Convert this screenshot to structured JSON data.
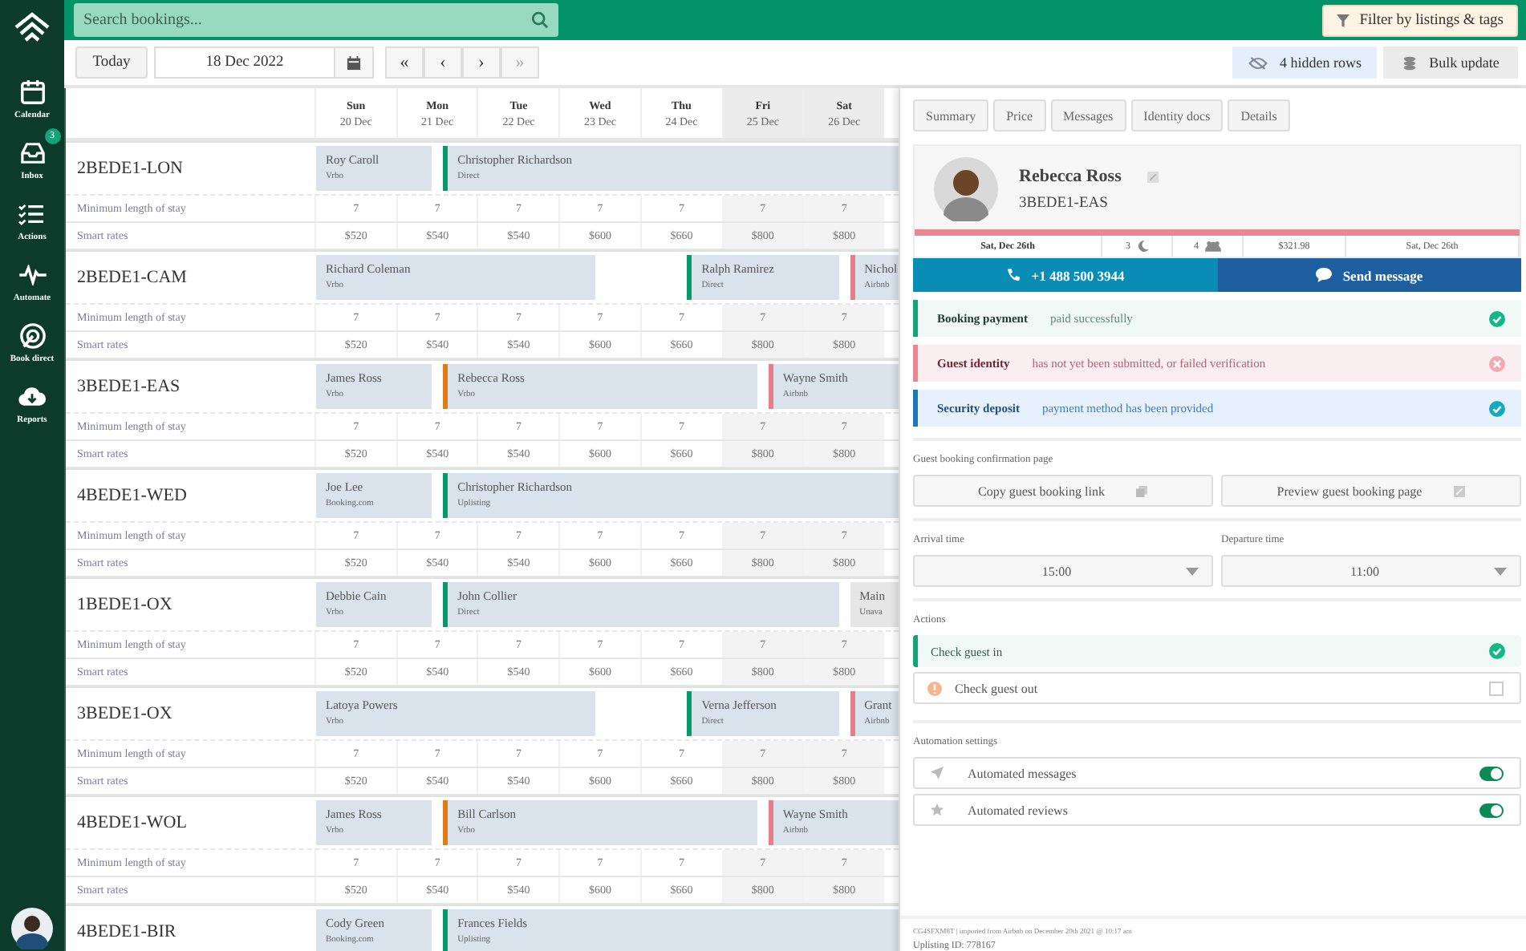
{
  "sidebar": {
    "items": [
      {
        "label": "Calendar"
      },
      {
        "label": "Inbox",
        "badge": "3"
      },
      {
        "label": "Actions"
      },
      {
        "label": "Automate"
      },
      {
        "label": "Book direct"
      },
      {
        "label": "Reports"
      }
    ]
  },
  "topbar": {
    "search": {
      "placeholder": "Search bookings..."
    },
    "filter_button": "Filter by listings & tags"
  },
  "toolbar": {
    "today_button": "Today",
    "date": "18 Dec 2022",
    "nav_buttons": [
      "«",
      "‹",
      "›",
      "»"
    ],
    "hidden_rows_button": "4 hidden rows",
    "bulk_update_button": "Bulk update"
  },
  "calendar": {
    "days": [
      {
        "weekday": "Sun",
        "date": "20 Dec",
        "weekend": false
      },
      {
        "weekday": "Mon",
        "date": "21 Dec",
        "weekend": false
      },
      {
        "weekday": "Tue",
        "date": "22 Dec",
        "weekend": false
      },
      {
        "weekday": "Wed",
        "date": "23 Dec",
        "weekend": false
      },
      {
        "weekday": "Thu",
        "date": "24 Dec",
        "weekend": false
      },
      {
        "weekday": "Fri",
        "date": "25 Dec",
        "weekend": true
      },
      {
        "weekday": "Sat",
        "date": "26 Dec",
        "weekend": true
      }
    ],
    "listings": [
      {
        "name": "2BEDE1-LON",
        "bookings": [
          {
            "kind": "booking",
            "guest": "Roy Caroll",
            "source": "Vrbo"
          },
          {
            "kind": "booking",
            "guest": "Christopher Richardson",
            "source": "Direct",
            "color": "#0a9a6a"
          }
        ],
        "min_stay_label": "Minimum length of stay",
        "min_stay": [
          "7",
          "7",
          "7",
          "7",
          "7",
          "7",
          "7"
        ],
        "rates_label": "Smart rates",
        "rates": [
          "$520",
          "$540",
          "$540",
          "$600",
          "$660",
          "$800",
          "$800"
        ]
      },
      {
        "name": "2BEDE1-CAM",
        "bookings": [
          {
            "kind": "booking",
            "guest": "Richard Coleman",
            "source": "Vrbo"
          },
          {
            "kind": "booking",
            "guest": "Ralph Ramirez",
            "source": "Direct",
            "color": "#0a9a6a"
          },
          {
            "kind": "booking",
            "guest": "Nichol",
            "source": "Airbnb",
            "color": "#e57f8a"
          }
        ],
        "min_stay_label": "Minimum length of stay",
        "min_stay": [
          "7",
          "7",
          "7",
          "7",
          "7",
          "7",
          "7"
        ],
        "rates_label": "Smart rates",
        "rates": [
          "$520",
          "$540",
          "$540",
          "$600",
          "$660",
          "$800",
          "$800"
        ]
      },
      {
        "name": "3BEDE1-EAS",
        "bookings": [
          {
            "kind": "booking",
            "guest": "James Ross",
            "source": "Vrbo"
          },
          {
            "kind": "booking",
            "guest": "Rebecca Ross",
            "source": "Vrbo",
            "color": "#e07b16"
          },
          {
            "kind": "booking",
            "guest": "Wayne Smith",
            "source": "Airbnb",
            "color": "#e57f8a"
          }
        ],
        "min_stay_label": "Minimum length of stay",
        "min_stay": [
          "7",
          "7",
          "7",
          "7",
          "7",
          "7",
          "7"
        ],
        "rates_label": "Smart rates",
        "rates": [
          "$520",
          "$540",
          "$540",
          "$600",
          "$660",
          "$800",
          "$800"
        ]
      },
      {
        "name": "4BEDE1-WED",
        "bookings": [
          {
            "kind": "booking",
            "guest": "Joe Lee",
            "source": "Booking.com"
          },
          {
            "kind": "booking",
            "guest": "Christopher Richardson",
            "source": "Uplisting",
            "color": "#0a9a6a"
          }
        ],
        "min_stay_label": "Minimum length of stay",
        "min_stay": [
          "7",
          "7",
          "7",
          "7",
          "7",
          "7",
          "7"
        ],
        "rates_label": "Smart rates",
        "rates": [
          "$520",
          "$540",
          "$540",
          "$600",
          "$660",
          "$800",
          "$800"
        ]
      },
      {
        "name": "1BEDE1-OX",
        "bookings": [
          {
            "kind": "booking",
            "guest": "Debbie Cain",
            "source": "Vrbo"
          },
          {
            "kind": "booking",
            "guest": "John Collier",
            "source": "Direct",
            "color": "#0a9a6a"
          },
          {
            "kind": "blocked",
            "guest": "Main",
            "source": "Unava"
          }
        ],
        "min_stay_label": "Minimum length of stay",
        "min_stay": [
          "7",
          "7",
          "7",
          "7",
          "7",
          "7",
          "7"
        ],
        "rates_label": "Smart rates",
        "rates": [
          "$520",
          "$540",
          "$540",
          "$600",
          "$660",
          "$800",
          "$800"
        ]
      },
      {
        "name": "3BEDE1-OX",
        "bookings": [
          {
            "kind": "booking",
            "guest": "Latoya Powers",
            "source": "Vrbo"
          },
          {
            "kind": "booking",
            "guest": "Verna Jefferson",
            "source": "Direct",
            "color": "#0a9a6a"
          },
          {
            "kind": "booking",
            "guest": "Grant",
            "source": "Airbnb",
            "color": "#e57f8a"
          }
        ],
        "min_stay_label": "Minimum length of stay",
        "min_stay": [
          "7",
          "7",
          "7",
          "7",
          "7",
          "7",
          "7"
        ],
        "rates_label": "Smart rates",
        "rates": [
          "$520",
          "$540",
          "$540",
          "$600",
          "$660",
          "$800",
          "$800"
        ]
      },
      {
        "name": "4BEDE1-WOL",
        "bookings": [
          {
            "kind": "booking",
            "guest": "James Ross",
            "source": "Vrbo"
          },
          {
            "kind": "booking",
            "guest": "Bill Carlson",
            "source": "Vrbo",
            "color": "#e07b16"
          },
          {
            "kind": "booking",
            "guest": "Wayne Smith",
            "source": "Airbnb",
            "color": "#e57f8a"
          }
        ],
        "min_stay_label": "Minimum length of stay",
        "min_stay": [
          "7",
          "7",
          "7",
          "7",
          "7",
          "7",
          "7"
        ],
        "rates_label": "Smart rates",
        "rates": [
          "$520",
          "$540",
          "$540",
          "$600",
          "$660",
          "$800",
          "$800"
        ]
      },
      {
        "name": "4BEDE1-BIR",
        "bookings": [
          {
            "kind": "booking",
            "guest": "Cody Green",
            "source": "Booking.com"
          },
          {
            "kind": "booking",
            "guest": "Frances Fields",
            "source": "Uplisting",
            "color": "#0a9a6a"
          }
        ]
      }
    ]
  },
  "panel": {
    "tabs": [
      {
        "label": "Summary",
        "selected": false
      },
      {
        "label": "Price",
        "selected": false
      },
      {
        "label": "Messages",
        "selected": false
      },
      {
        "label": "Identity docs",
        "selected": false
      },
      {
        "label": "Details",
        "selected": false
      }
    ],
    "guest": {
      "name": "Rebecca Ross",
      "listing": "3BEDE1-EAS"
    },
    "stats": [
      "Sat, Dec 26th",
      "3",
      "4",
      "$321.98",
      "Sat, Dec 26th"
    ],
    "call_button": "+1 488 500 3944",
    "message_button": "Send message",
    "statuses": [
      {
        "kind": "success",
        "title": "Booking payment",
        "text": "paid successfully"
      },
      {
        "kind": "error",
        "title": "Guest identity",
        "text": "has not yet been submitted, or failed verification"
      },
      {
        "kind": "info",
        "title": "Security deposit",
        "text": "payment method has been provided"
      }
    ],
    "confirmation": {
      "heading": "Guest booking confirmation page",
      "buttons": [
        "Copy guest booking link",
        "Preview guest booking page"
      ]
    },
    "times": [
      {
        "label": "Arrival time",
        "value": "15:00"
      },
      {
        "label": "Departure time",
        "value": "11:00"
      }
    ],
    "actions": {
      "heading": "Actions",
      "items": [
        {
          "label": "Check guest in",
          "checked": true
        },
        {
          "label": "Check guest out",
          "checked": false
        }
      ]
    },
    "automation": {
      "heading": "Automation settings",
      "items": [
        {
          "label": "Automated messages",
          "on": true
        },
        {
          "label": "Automated reviews",
          "on": true
        }
      ]
    },
    "footer": {
      "import_note": "CG4SFXM8T | imported from Airbnb on December 20th 2021 @ 10:17 am",
      "id_line": "Uplisting ID: 778167"
    }
  }
}
